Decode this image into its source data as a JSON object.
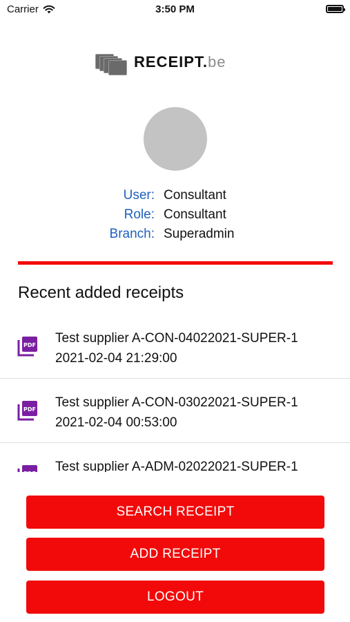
{
  "status_bar": {
    "carrier": "Carrier",
    "time": "3:50 PM"
  },
  "logo": {
    "main": "RECEIPT.",
    "suffix": "be"
  },
  "profile": {
    "rows": [
      {
        "label": "User:",
        "value": "Consultant"
      },
      {
        "label": "Role:",
        "value": "Consultant"
      },
      {
        "label": "Branch:",
        "value": "Superadmin"
      }
    ]
  },
  "recent": {
    "title": "Recent added receipts",
    "items": [
      {
        "icon": "pdf-file-icon",
        "name": "Test supplier A-CON-04022021-SUPER-1",
        "date": "2021-02-04 21:29:00"
      },
      {
        "icon": "pdf-file-icon",
        "name": "Test supplier A-CON-03022021-SUPER-1",
        "date": "2021-02-04 00:53:00"
      },
      {
        "icon": "pdf-file-icon",
        "name": "Test supplier A-ADM-02022021-SUPER-1",
        "date": ""
      }
    ]
  },
  "buttons": {
    "search": "SEARCH RECEIPT",
    "add": "ADD RECEIPT",
    "logout": "LOGOUT"
  },
  "colors": {
    "accent_red": "#f20a0a",
    "label_blue": "#1f5fbf",
    "pdf_purple": "#7b1fa2",
    "avatar_gray": "#c3c3c3"
  }
}
